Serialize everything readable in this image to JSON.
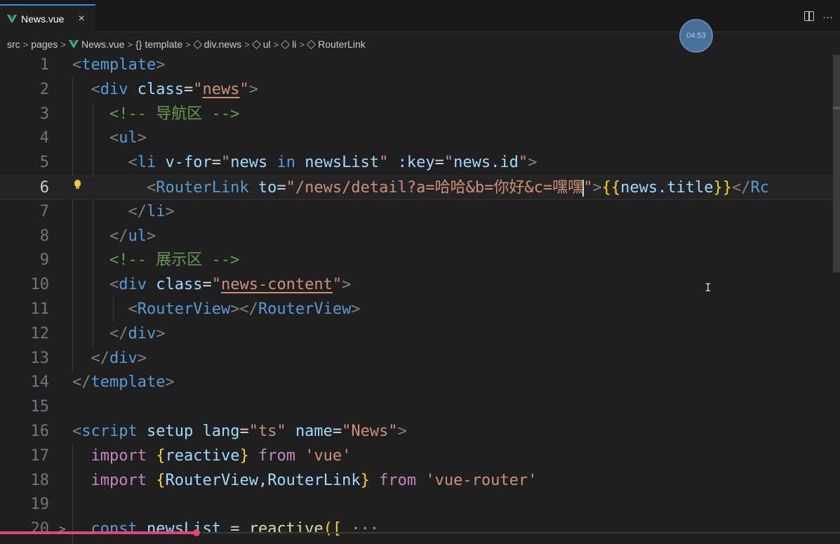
{
  "tab": {
    "label": "News.vue",
    "close": "×",
    "more": "···"
  },
  "timer": "04:53",
  "breadcrumb": {
    "src": "src",
    "pages": "pages",
    "file": "News.vue",
    "template_braces": "{}",
    "template": "template",
    "div": "div.news",
    "ul": "ul",
    "li": "li",
    "routerlink": "RouterLink",
    "sep": ">"
  },
  "editor": {
    "current_line": 6,
    "lines": [
      {
        "n": "1",
        "segments": [
          {
            "c": "t",
            "v": "<"
          },
          {
            "c": "tn",
            "v": "template"
          },
          {
            "c": "t",
            "v": ">"
          }
        ]
      },
      {
        "n": "2",
        "segments": [
          {
            "c": "pl",
            "v": "  "
          },
          {
            "c": "t",
            "v": "<"
          },
          {
            "c": "tn",
            "v": "div"
          },
          {
            "c": "pl",
            "v": " "
          },
          {
            "c": "at",
            "v": "class"
          },
          {
            "c": "pl",
            "v": "="
          },
          {
            "c": "st",
            "v": "\""
          },
          {
            "c": "st ul-st",
            "v": "news"
          },
          {
            "c": "st",
            "v": "\""
          },
          {
            "c": "t",
            "v": ">"
          }
        ]
      },
      {
        "n": "3",
        "segments": [
          {
            "c": "pl",
            "v": "    "
          },
          {
            "c": "cm",
            "v": "<!-- 导航区 -->"
          }
        ]
      },
      {
        "n": "4",
        "segments": [
          {
            "c": "pl",
            "v": "    "
          },
          {
            "c": "t",
            "v": "<"
          },
          {
            "c": "tn",
            "v": "ul"
          },
          {
            "c": "t",
            "v": ">"
          }
        ]
      },
      {
        "n": "5",
        "segments": [
          {
            "c": "pl",
            "v": "      "
          },
          {
            "c": "t",
            "v": "<"
          },
          {
            "c": "tn",
            "v": "li"
          },
          {
            "c": "pl",
            "v": " "
          },
          {
            "c": "at",
            "v": "v-for"
          },
          {
            "c": "pl",
            "v": "="
          },
          {
            "c": "st",
            "v": "\""
          },
          {
            "c": "vr",
            "v": "news"
          },
          {
            "c": "pl",
            "v": " "
          },
          {
            "c": "tn",
            "v": "in"
          },
          {
            "c": "pl",
            "v": " "
          },
          {
            "c": "vr",
            "v": "newsList"
          },
          {
            "c": "st",
            "v": "\""
          },
          {
            "c": "pl",
            "v": " "
          },
          {
            "c": "at",
            "v": ":key"
          },
          {
            "c": "pl",
            "v": "="
          },
          {
            "c": "st",
            "v": "\""
          },
          {
            "c": "vr",
            "v": "news.id"
          },
          {
            "c": "st",
            "v": "\""
          },
          {
            "c": "t",
            "v": ">"
          }
        ]
      },
      {
        "n": "6",
        "segments": [
          {
            "c": "pl",
            "v": "        "
          },
          {
            "c": "t",
            "v": "<"
          },
          {
            "c": "tn",
            "v": "RouterLink"
          },
          {
            "c": "pl",
            "v": " "
          },
          {
            "c": "at",
            "v": "to"
          },
          {
            "c": "pl",
            "v": "="
          },
          {
            "c": "st",
            "v": "\"/news/detail?a=哈哈&b=你好&c=嘿嘿"
          },
          {
            "c": "cursor",
            "v": ""
          },
          {
            "c": "st",
            "v": "\""
          },
          {
            "c": "t",
            "v": ">"
          },
          {
            "c": "br",
            "v": "{{"
          },
          {
            "c": "vr",
            "v": "news.title"
          },
          {
            "c": "br",
            "v": "}}"
          },
          {
            "c": "t",
            "v": "</"
          },
          {
            "c": "tn",
            "v": "Rc"
          }
        ]
      },
      {
        "n": "7",
        "segments": [
          {
            "c": "pl",
            "v": "      "
          },
          {
            "c": "t",
            "v": "</"
          },
          {
            "c": "tn",
            "v": "li"
          },
          {
            "c": "t",
            "v": ">"
          }
        ]
      },
      {
        "n": "8",
        "segments": [
          {
            "c": "pl",
            "v": "    "
          },
          {
            "c": "t",
            "v": "</"
          },
          {
            "c": "tn",
            "v": "ul"
          },
          {
            "c": "t",
            "v": ">"
          }
        ]
      },
      {
        "n": "9",
        "segments": [
          {
            "c": "pl",
            "v": "    "
          },
          {
            "c": "cm",
            "v": "<!-- 展示区 -->"
          }
        ]
      },
      {
        "n": "10",
        "segments": [
          {
            "c": "pl",
            "v": "    "
          },
          {
            "c": "t",
            "v": "<"
          },
          {
            "c": "tn",
            "v": "div"
          },
          {
            "c": "pl",
            "v": " "
          },
          {
            "c": "at",
            "v": "class"
          },
          {
            "c": "pl",
            "v": "="
          },
          {
            "c": "st",
            "v": "\""
          },
          {
            "c": "st ul-st",
            "v": "news-content"
          },
          {
            "c": "st",
            "v": "\""
          },
          {
            "c": "t",
            "v": ">"
          }
        ]
      },
      {
        "n": "11",
        "segments": [
          {
            "c": "pl",
            "v": "      "
          },
          {
            "c": "t",
            "v": "<"
          },
          {
            "c": "tn",
            "v": "RouterView"
          },
          {
            "c": "t",
            "v": "></"
          },
          {
            "c": "tn",
            "v": "RouterView"
          },
          {
            "c": "t",
            "v": ">"
          }
        ]
      },
      {
        "n": "12",
        "segments": [
          {
            "c": "pl",
            "v": "    "
          },
          {
            "c": "t",
            "v": "</"
          },
          {
            "c": "tn",
            "v": "div"
          },
          {
            "c": "t",
            "v": ">"
          }
        ]
      },
      {
        "n": "13",
        "segments": [
          {
            "c": "pl",
            "v": "  "
          },
          {
            "c": "t",
            "v": "</"
          },
          {
            "c": "tn",
            "v": "div"
          },
          {
            "c": "t",
            "v": ">"
          }
        ]
      },
      {
        "n": "14",
        "segments": [
          {
            "c": "t",
            "v": "</"
          },
          {
            "c": "tn",
            "v": "template"
          },
          {
            "c": "t",
            "v": ">"
          }
        ]
      },
      {
        "n": "15",
        "segments": []
      },
      {
        "n": "16",
        "segments": [
          {
            "c": "t",
            "v": "<"
          },
          {
            "c": "tn",
            "v": "script"
          },
          {
            "c": "pl",
            "v": " "
          },
          {
            "c": "at",
            "v": "setup"
          },
          {
            "c": "pl",
            "v": " "
          },
          {
            "c": "at",
            "v": "lang"
          },
          {
            "c": "pl",
            "v": "="
          },
          {
            "c": "st",
            "v": "\"ts\""
          },
          {
            "c": "pl",
            "v": " "
          },
          {
            "c": "at",
            "v": "name"
          },
          {
            "c": "pl",
            "v": "="
          },
          {
            "c": "st",
            "v": "\"News\""
          },
          {
            "c": "t",
            "v": ">"
          }
        ]
      },
      {
        "n": "17",
        "segments": [
          {
            "c": "pl",
            "v": "  "
          },
          {
            "c": "kw",
            "v": "import"
          },
          {
            "c": "pl",
            "v": " "
          },
          {
            "c": "br",
            "v": "{"
          },
          {
            "c": "vr",
            "v": "reactive"
          },
          {
            "c": "br",
            "v": "}"
          },
          {
            "c": "pl",
            "v": " "
          },
          {
            "c": "kw",
            "v": "from"
          },
          {
            "c": "pl",
            "v": " "
          },
          {
            "c": "st",
            "v": "'vue'"
          }
        ]
      },
      {
        "n": "18",
        "segments": [
          {
            "c": "pl",
            "v": "  "
          },
          {
            "c": "kw",
            "v": "import"
          },
          {
            "c": "pl",
            "v": " "
          },
          {
            "c": "br",
            "v": "{"
          },
          {
            "c": "vr",
            "v": "RouterView"
          },
          {
            "c": "pl",
            "v": ","
          },
          {
            "c": "vr",
            "v": "RouterLink"
          },
          {
            "c": "br",
            "v": "}"
          },
          {
            "c": "pl",
            "v": " "
          },
          {
            "c": "kw",
            "v": "from"
          },
          {
            "c": "pl",
            "v": " "
          },
          {
            "c": "st",
            "v": "'vue-router'"
          }
        ]
      },
      {
        "n": "19",
        "segments": []
      },
      {
        "n": "20",
        "fold": ">",
        "segments": [
          {
            "c": "pl",
            "v": "  "
          },
          {
            "c": "tn",
            "v": "const"
          },
          {
            "c": "pl",
            "v": " "
          },
          {
            "c": "vr",
            "v": "newsList"
          },
          {
            "c": "pl",
            "v": " = "
          },
          {
            "c": "fn",
            "v": "reactive"
          },
          {
            "c": "br",
            "v": "(["
          },
          {
            "c": "pl",
            "v": " "
          },
          {
            "c": "ellipsis",
            "v": "···"
          }
        ]
      }
    ]
  }
}
